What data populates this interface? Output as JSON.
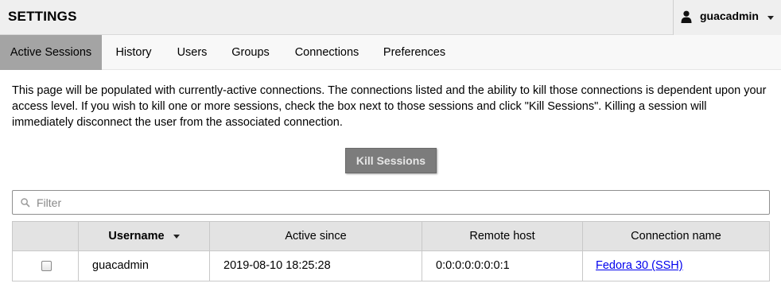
{
  "header": {
    "title": "SETTINGS",
    "user": {
      "name": "guacadmin",
      "icon": "user-icon"
    }
  },
  "tabs": [
    {
      "label": "Active Sessions",
      "active": true
    },
    {
      "label": "History",
      "active": false
    },
    {
      "label": "Users",
      "active": false
    },
    {
      "label": "Groups",
      "active": false
    },
    {
      "label": "Connections",
      "active": false
    },
    {
      "label": "Preferences",
      "active": false
    }
  ],
  "description": "This page will be populated with currently-active connections. The connections listed and the ability to kill those connections is dependent upon your access level. If you wish to kill one or more sessions, check the box next to those sessions and click \"Kill Sessions\". Killing a session will immediately disconnect the user from the associated connection.",
  "kill_button": {
    "label": "Kill Sessions",
    "enabled": false
  },
  "filter": {
    "placeholder": "Filter",
    "value": "",
    "icon": "search-icon"
  },
  "table": {
    "columns": [
      "",
      "Username",
      "Active since",
      "Remote host",
      "Connection name"
    ],
    "sorted_by": "Username",
    "rows": [
      {
        "checked": false,
        "username": "guacadmin",
        "active_since": "2019-08-10 18:25:28",
        "remote_host": "0:0:0:0:0:0:0:1",
        "connection_name": "Fedora 30 (SSH)"
      }
    ]
  },
  "colors": {
    "header_bg": "#efefef",
    "active_tab_bg": "#a4a4a4",
    "button_bg": "#7c7c7c",
    "table_header_bg": "#e3e3e3",
    "link": "#0000ee"
  }
}
